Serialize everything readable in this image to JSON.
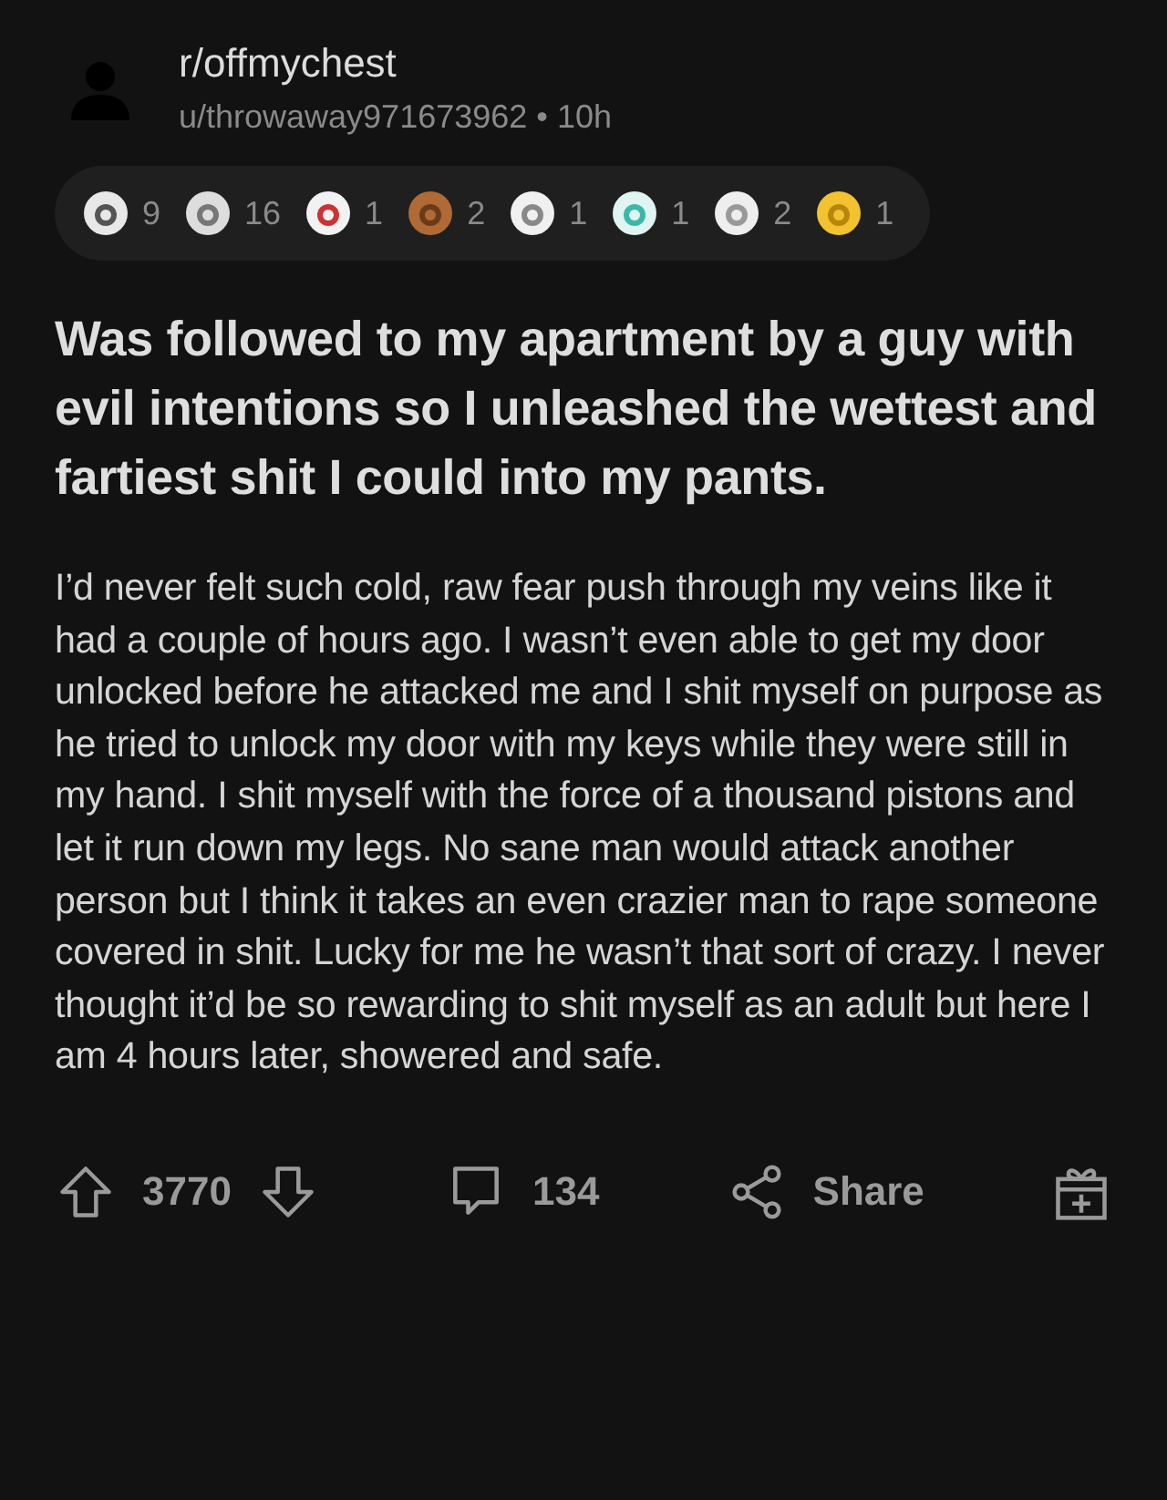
{
  "post": {
    "subreddit": "r/offmychest",
    "author": "u/throwaway971673962",
    "separator": "•",
    "time": "10h",
    "awards": [
      {
        "count": "9"
      },
      {
        "count": "16"
      },
      {
        "count": "1"
      },
      {
        "count": "2"
      },
      {
        "count": "1"
      },
      {
        "count": "1"
      },
      {
        "count": "2"
      },
      {
        "count": "1"
      }
    ],
    "title": "Was followed to my apartment by a guy with evil intentions so I unleashed the wettest and fartiest shit I could into my pants.",
    "body": "I’d never felt such cold, raw fear push through my veins like it had a couple of hours ago. I wasn’t even able to get my door unlocked before he attacked me and I shit myself on purpose as he tried to unlock my door with my keys while they were still in my hand. I shit myself with the force of a thousand pistons and let it run down my legs. No sane man would attack another person but I think it takes an even crazier man to rape someone covered in shit. Lucky for me he wasn’t that sort of crazy. I never thought it’d be so rewarding to shit myself as an adult but here I am 4 hours later, showered and safe.",
    "score": "3770",
    "comments": "134",
    "share": "Share"
  }
}
